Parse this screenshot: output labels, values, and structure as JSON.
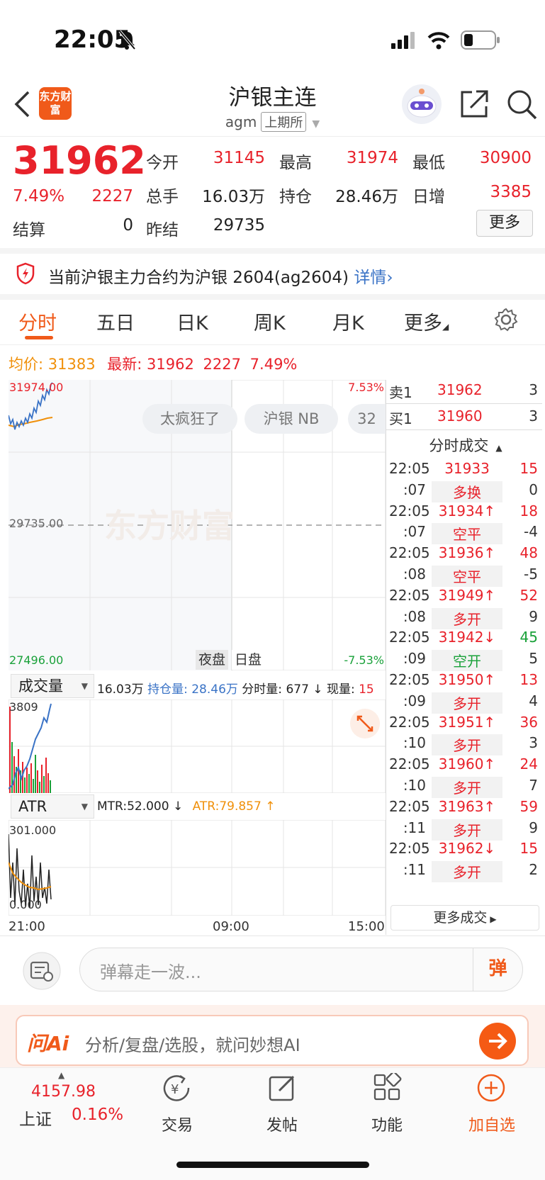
{
  "status_bar": {
    "time": "22:05"
  },
  "nav": {
    "logo_text": "东方财富",
    "title": "沪银主连",
    "code": "agm",
    "exchange": "上期所"
  },
  "quote": {
    "price": "31962",
    "change_pct": "7.49%",
    "change": "2227",
    "settle_label": "结算",
    "settle_value": "0",
    "open_label": "今开",
    "open_value": "31145",
    "high_label": "最高",
    "high_value": "31974",
    "low_label": "最低",
    "low_value": "30900",
    "volume_label": "总手",
    "volume_value": "16.03万",
    "oi_label": "持仓",
    "oi_value": "28.46万",
    "daily_inc_label": "日增",
    "daily_inc_value": "3385",
    "prev_settle_label": "昨结",
    "prev_settle_value": "29735",
    "more_label": "更多"
  },
  "notice": {
    "text": "当前沪银主力合约为沪银 2604(ag2604)",
    "link": "详情"
  },
  "tabs": [
    {
      "label": "分时"
    },
    {
      "label": "五日"
    },
    {
      "label": "日K"
    },
    {
      "label": "周K"
    },
    {
      "label": "月K"
    },
    {
      "label": "更多"
    }
  ],
  "chart": {
    "avg_label": "均价:",
    "avg_value": "31383",
    "latest_label": "最新:",
    "latest_value": "31962",
    "latest_change": "2227",
    "latest_pct": "7.49%",
    "y_top": "31974.00",
    "y_mid": "29735.00",
    "y_bottom": "27496.00",
    "pct_top": "7.53%",
    "pct_bottom": "-7.53%",
    "watermark": "东方财富",
    "session_night": "夜盘",
    "session_day": "日盘",
    "bubbles": [
      "太疯狂了",
      "沪银 NB",
      "32"
    ],
    "x_labels": [
      "21:00",
      "09:00",
      "15:00"
    ]
  },
  "volume_panel": {
    "selector": "成交量",
    "total": "16.03万",
    "oi_label": "持仓量:",
    "oi_value": "28.46万",
    "tick_vol_label": "分时量:",
    "tick_vol_value": "677 ↓",
    "now_label": "现量:",
    "now_value": "15",
    "max": "3809"
  },
  "atr_panel": {
    "selector": "ATR",
    "mtr": "MTR:52.000 ↓",
    "atr": "ATR:79.857 ↑",
    "max": "301.000",
    "min": "0.000"
  },
  "order_book": {
    "sell_label": "卖1",
    "sell_price": "31962",
    "sell_vol": "3",
    "buy_label": "买1",
    "buy_price": "31960",
    "buy_vol": "3",
    "ticks_header": "分时成交",
    "more_ticks": "更多成交"
  },
  "ticks": [
    {
      "time": "22:05",
      "price": "31933",
      "vol": "15",
      "vcolor": "red",
      "pcolor": "red"
    },
    {
      "time": ":07",
      "price": "多换",
      "vol": "0",
      "vcolor": "dark",
      "pcolor": "red",
      "type": true
    },
    {
      "time": "22:05",
      "price": "31934↑",
      "vol": "18",
      "vcolor": "red",
      "pcolor": "red"
    },
    {
      "time": ":07",
      "price": "空平",
      "vol": "-4",
      "vcolor": "dark",
      "pcolor": "red",
      "type": true
    },
    {
      "time": "22:05",
      "price": "31936↑",
      "vol": "48",
      "vcolor": "red",
      "pcolor": "red"
    },
    {
      "time": ":08",
      "price": "空平",
      "vol": "-5",
      "vcolor": "dark",
      "pcolor": "red",
      "type": true
    },
    {
      "time": "22:05",
      "price": "31949↑",
      "vol": "52",
      "vcolor": "red",
      "pcolor": "red"
    },
    {
      "time": ":08",
      "price": "多开",
      "vol": "9",
      "vcolor": "dark",
      "pcolor": "red",
      "type": true
    },
    {
      "time": "22:05",
      "price": "31942↓",
      "vol": "45",
      "vcolor": "green",
      "pcolor": "red"
    },
    {
      "time": ":09",
      "price": "空开",
      "vol": "5",
      "vcolor": "dark",
      "pcolor": "green",
      "type": true
    },
    {
      "time": "22:05",
      "price": "31950↑",
      "vol": "13",
      "vcolor": "red",
      "pcolor": "red"
    },
    {
      "time": ":09",
      "price": "多开",
      "vol": "4",
      "vcolor": "dark",
      "pcolor": "red",
      "type": true
    },
    {
      "time": "22:05",
      "price": "31951↑",
      "vol": "36",
      "vcolor": "red",
      "pcolor": "red"
    },
    {
      "time": ":10",
      "price": "多开",
      "vol": "3",
      "vcolor": "dark",
      "pcolor": "red",
      "type": true
    },
    {
      "time": "22:05",
      "price": "31960↑",
      "vol": "24",
      "vcolor": "red",
      "pcolor": "red"
    },
    {
      "time": ":10",
      "price": "多开",
      "vol": "7",
      "vcolor": "dark",
      "pcolor": "red",
      "type": true
    },
    {
      "time": "22:05",
      "price": "31963↑",
      "vol": "59",
      "vcolor": "red",
      "pcolor": "red"
    },
    {
      "time": ":11",
      "price": "多开",
      "vol": "9",
      "vcolor": "dark",
      "pcolor": "red",
      "type": true
    },
    {
      "time": "22:05",
      "price": "31962↓",
      "vol": "15",
      "vcolor": "red",
      "pcolor": "red"
    },
    {
      "time": ":11",
      "price": "多开",
      "vol": "2",
      "vcolor": "dark",
      "pcolor": "red",
      "type": true
    }
  ],
  "comment": {
    "placeholder": "弹幕走一波...",
    "danmu": "弹"
  },
  "ai_bar": {
    "brand": "问Ai",
    "text": "分析/复盘/选股，就问妙想AI"
  },
  "bottom_nav": {
    "index_value": "4157.98",
    "index_name": "上证",
    "index_pct": "0.16%",
    "trade": "交易",
    "post": "发帖",
    "function": "功能",
    "add": "加自选"
  }
}
